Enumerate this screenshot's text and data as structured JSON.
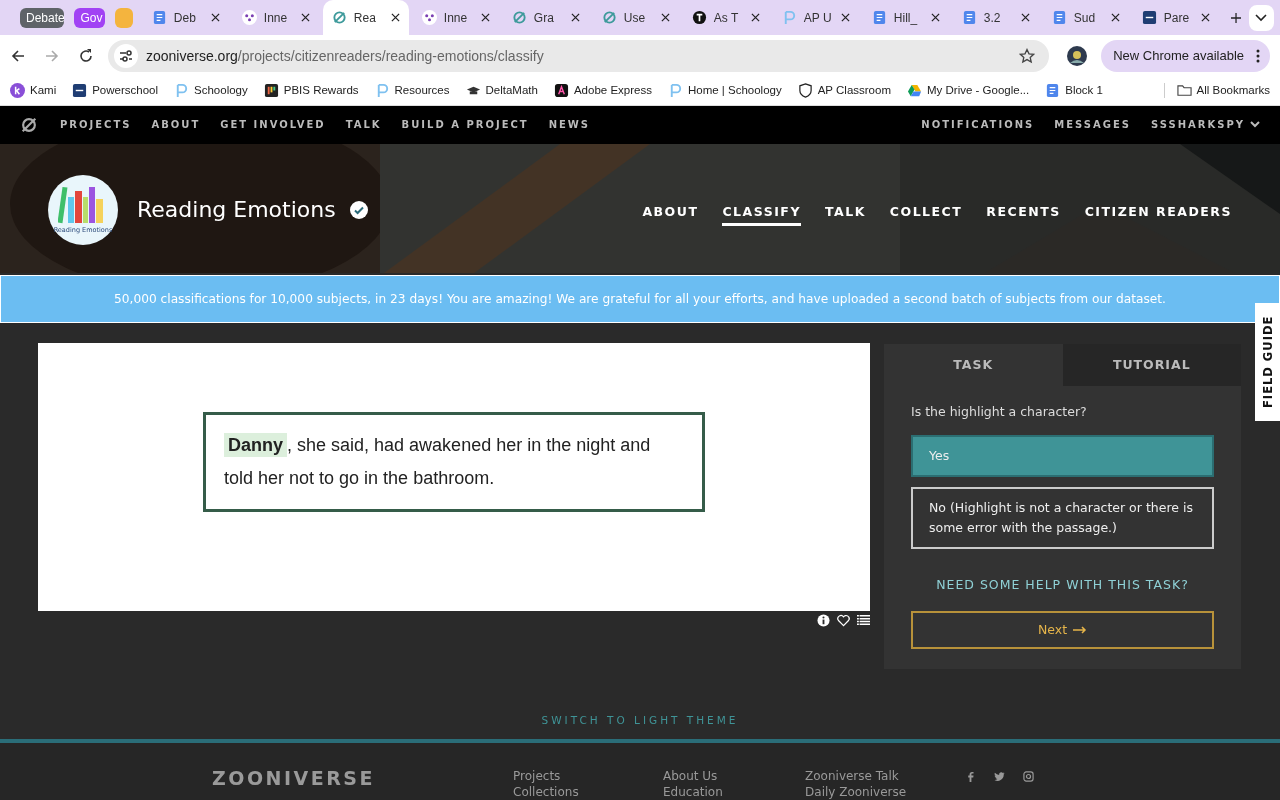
{
  "browser": {
    "tab_groups": [
      {
        "label": "Debate",
        "color": "#5f6368"
      },
      {
        "label": "Gov",
        "color": "#a142f4"
      },
      {
        "color": "#f4b43e"
      }
    ],
    "tabs": [
      {
        "title": "Deb",
        "kind": "docs",
        "selected": false
      },
      {
        "title": "Inne",
        "kind": "inner",
        "selected": false
      },
      {
        "title": "Rea",
        "kind": "zoo",
        "selected": true
      },
      {
        "title": "Inne",
        "kind": "inner",
        "selected": false
      },
      {
        "title": "Gra",
        "kind": "zoo",
        "selected": false
      },
      {
        "title": "Use",
        "kind": "zoo",
        "selected": false
      },
      {
        "title": "As T",
        "kind": "nyt",
        "selected": false
      },
      {
        "title": "AP U",
        "kind": "schoology",
        "selected": false
      },
      {
        "title": "Hill_",
        "kind": "docs",
        "selected": false
      },
      {
        "title": "3.2",
        "kind": "docs",
        "selected": false
      },
      {
        "title": "Sud",
        "kind": "docs",
        "selected": false
      },
      {
        "title": "Pare",
        "kind": "sis",
        "selected": false
      }
    ],
    "address": {
      "domain": "zooniverse.org",
      "path": "/projects/citizenreaders/reading-emotions/classify"
    },
    "update_button": "New Chrome available",
    "bookmarks": [
      {
        "label": "Kami",
        "kind": "kami"
      },
      {
        "label": "Powerschool",
        "kind": "sis"
      },
      {
        "label": "Schoology",
        "kind": "schoology"
      },
      {
        "label": "PBIS Rewards",
        "kind": "pbis"
      },
      {
        "label": "Resources",
        "kind": "schoology"
      },
      {
        "label": "DeltaMath",
        "kind": "cap"
      },
      {
        "label": "Adobe Express",
        "kind": "adobe"
      },
      {
        "label": "Home | Schoology",
        "kind": "schoology"
      },
      {
        "label": "AP Classroom",
        "kind": "shield"
      },
      {
        "label": "My Drive - Google...",
        "kind": "drive"
      },
      {
        "label": "Block 1",
        "kind": "docs"
      }
    ],
    "all_bookmarks": "All Bookmarks"
  },
  "site_nav": {
    "left": [
      "PROJECTS",
      "ABOUT",
      "GET INVOLVED",
      "TALK",
      "BUILD A PROJECT",
      "NEWS"
    ],
    "right": [
      "NOTIFICATIONS",
      "MESSAGES"
    ],
    "user": "SSSHARKSPY"
  },
  "project": {
    "title": "Reading Emotions",
    "logo_caption": "Reading Emotions",
    "verified": true,
    "nav": [
      {
        "label": "ABOUT",
        "selected": false
      },
      {
        "label": "CLASSIFY",
        "selected": true
      },
      {
        "label": "TALK",
        "selected": false
      },
      {
        "label": "COLLECT",
        "selected": false
      },
      {
        "label": "RECENTS",
        "selected": false
      },
      {
        "label": "CITIZEN READERS",
        "selected": false
      }
    ]
  },
  "banner": "50,000 classifications for 10,000 subjects, in 23 days! You are amazing! We are grateful for all your efforts, and have uploaded a second batch of subjects from our dataset.",
  "subject": {
    "highlight": "Danny",
    "text": ", she said, had awakened her in the night and told her not to go in the bathroom."
  },
  "task_panel": {
    "tabs": [
      {
        "label": "TASK",
        "selected": true
      },
      {
        "label": "TUTORIAL",
        "selected": false
      }
    ],
    "question": "Is the highlight a character?",
    "answers": [
      {
        "label": "Yes",
        "selected": true
      },
      {
        "label": "No (Highlight is not a character or there is some error with the passage.)",
        "selected": false
      }
    ],
    "help": "NEED SOME HELP WITH THIS TASK?",
    "next": "Next"
  },
  "field_guide": "FIELD GUIDE",
  "theme_toggle": "SWITCH TO LIGHT THEME",
  "footer": {
    "logo": "ZOONIVERSE",
    "columns": [
      [
        "Projects",
        "Collections"
      ],
      [
        "About Us",
        "Education"
      ],
      [
        "Zooniverse Talk",
        "Daily Zooniverse"
      ]
    ]
  }
}
